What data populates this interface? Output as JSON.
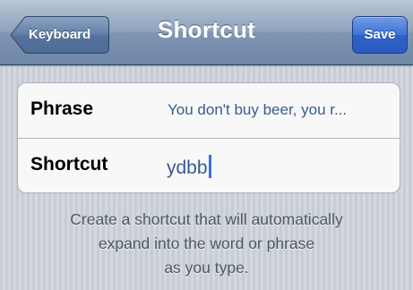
{
  "navbar": {
    "title": "Shortcut",
    "back_label": "Keyboard",
    "save_label": "Save"
  },
  "form": {
    "rows": [
      {
        "label": "Phrase",
        "value": "You don't buy beer, you r..."
      },
      {
        "label": "Shortcut",
        "value": "ydbb"
      }
    ]
  },
  "footer": {
    "lines": [
      "Create a shortcut that will automatically",
      "expand into the word or phrase",
      "as you type."
    ]
  },
  "colors": {
    "save_button": "#3f73d6",
    "value_text": "#3b5b8f",
    "caret": "#3a6fe0"
  }
}
